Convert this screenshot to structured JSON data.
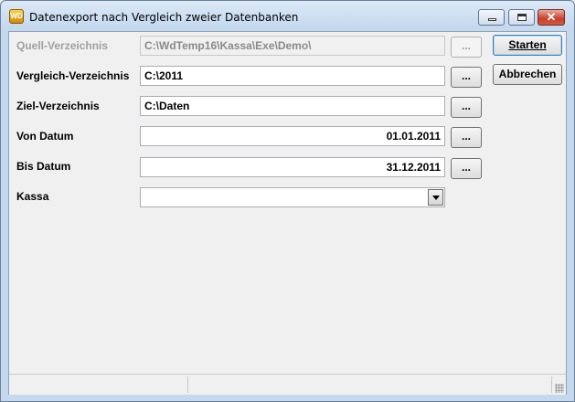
{
  "window": {
    "title": "Datenexport nach Vergleich zweier Datenbanken",
    "icon": "wd-app-icon",
    "icon_text": "WD"
  },
  "titlebar_buttons": {
    "close_glyph": "✕"
  },
  "form": {
    "quell": {
      "label": "Quell-Verzeichnis",
      "value": "C:\\WdTemp16\\Kassa\\Exe\\Demo\\",
      "browse": "...",
      "enabled": false
    },
    "vergleich": {
      "label": "Vergleich-Verzeichnis",
      "value": "C:\\2011",
      "browse": "..."
    },
    "ziel": {
      "label": "Ziel-Verzeichnis",
      "value": "C:\\Daten",
      "browse": "..."
    },
    "von": {
      "label": "Von Datum",
      "value": "01.01.2011",
      "browse": "..."
    },
    "bis": {
      "label": "Bis Datum",
      "value": "31.12.2011",
      "browse": "..."
    },
    "kassa": {
      "label": "Kassa",
      "value": ""
    }
  },
  "actions": {
    "start_label": "Starten",
    "cancel_label": "Abbrechen"
  },
  "colors": {
    "disabled_text": "#a0a0a0",
    "default_button_border": "#3c7fb1"
  }
}
